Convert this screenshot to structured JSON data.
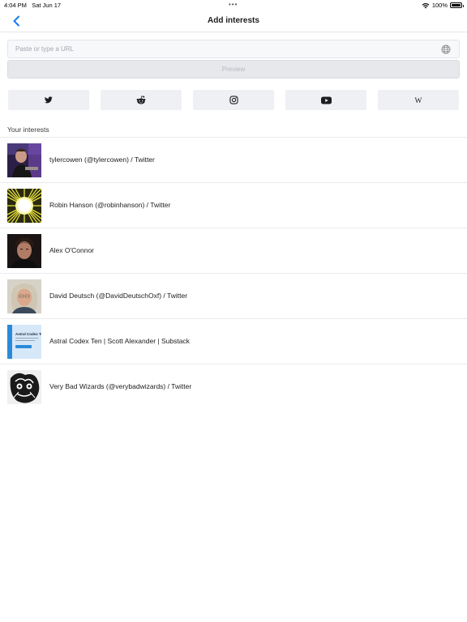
{
  "status_bar": {
    "time": "4:04 PM",
    "date": "Sat Jun 17",
    "battery": "100%"
  },
  "nav": {
    "title": "Add interests",
    "back_icon": "chevron-left-icon"
  },
  "url_input": {
    "placeholder": "Paste or type a URL",
    "value": "",
    "icon": "globe-icon"
  },
  "preview_button": {
    "label": "Preview"
  },
  "sources": [
    {
      "name": "twitter",
      "icon": "twitter-icon"
    },
    {
      "name": "reddit",
      "icon": "reddit-icon"
    },
    {
      "name": "instagram",
      "icon": "instagram-icon"
    },
    {
      "name": "youtube",
      "icon": "youtube-icon"
    },
    {
      "name": "wikipedia",
      "icon": "wikipedia-icon"
    }
  ],
  "section": {
    "your_interests": "Your interests"
  },
  "interests": [
    {
      "title": "tylercowen (@tylercowen) / Twitter"
    },
    {
      "title": "Robin Hanson (@robinhanson) / Twitter"
    },
    {
      "title": "Alex O'Connor"
    },
    {
      "title": "David Deutsch (@DavidDeutschOxf) / Twitter"
    },
    {
      "title": "Astral Codex Ten | Scott Alexander | Substack",
      "thumb_text": "Astral Codex Te"
    },
    {
      "title": "Very Bad Wizards (@verybadwizards) / Twitter"
    }
  ],
  "colors": {
    "accent": "#1a7ae8",
    "divider": "#ebebee",
    "source_bg": "#eef0f3"
  }
}
